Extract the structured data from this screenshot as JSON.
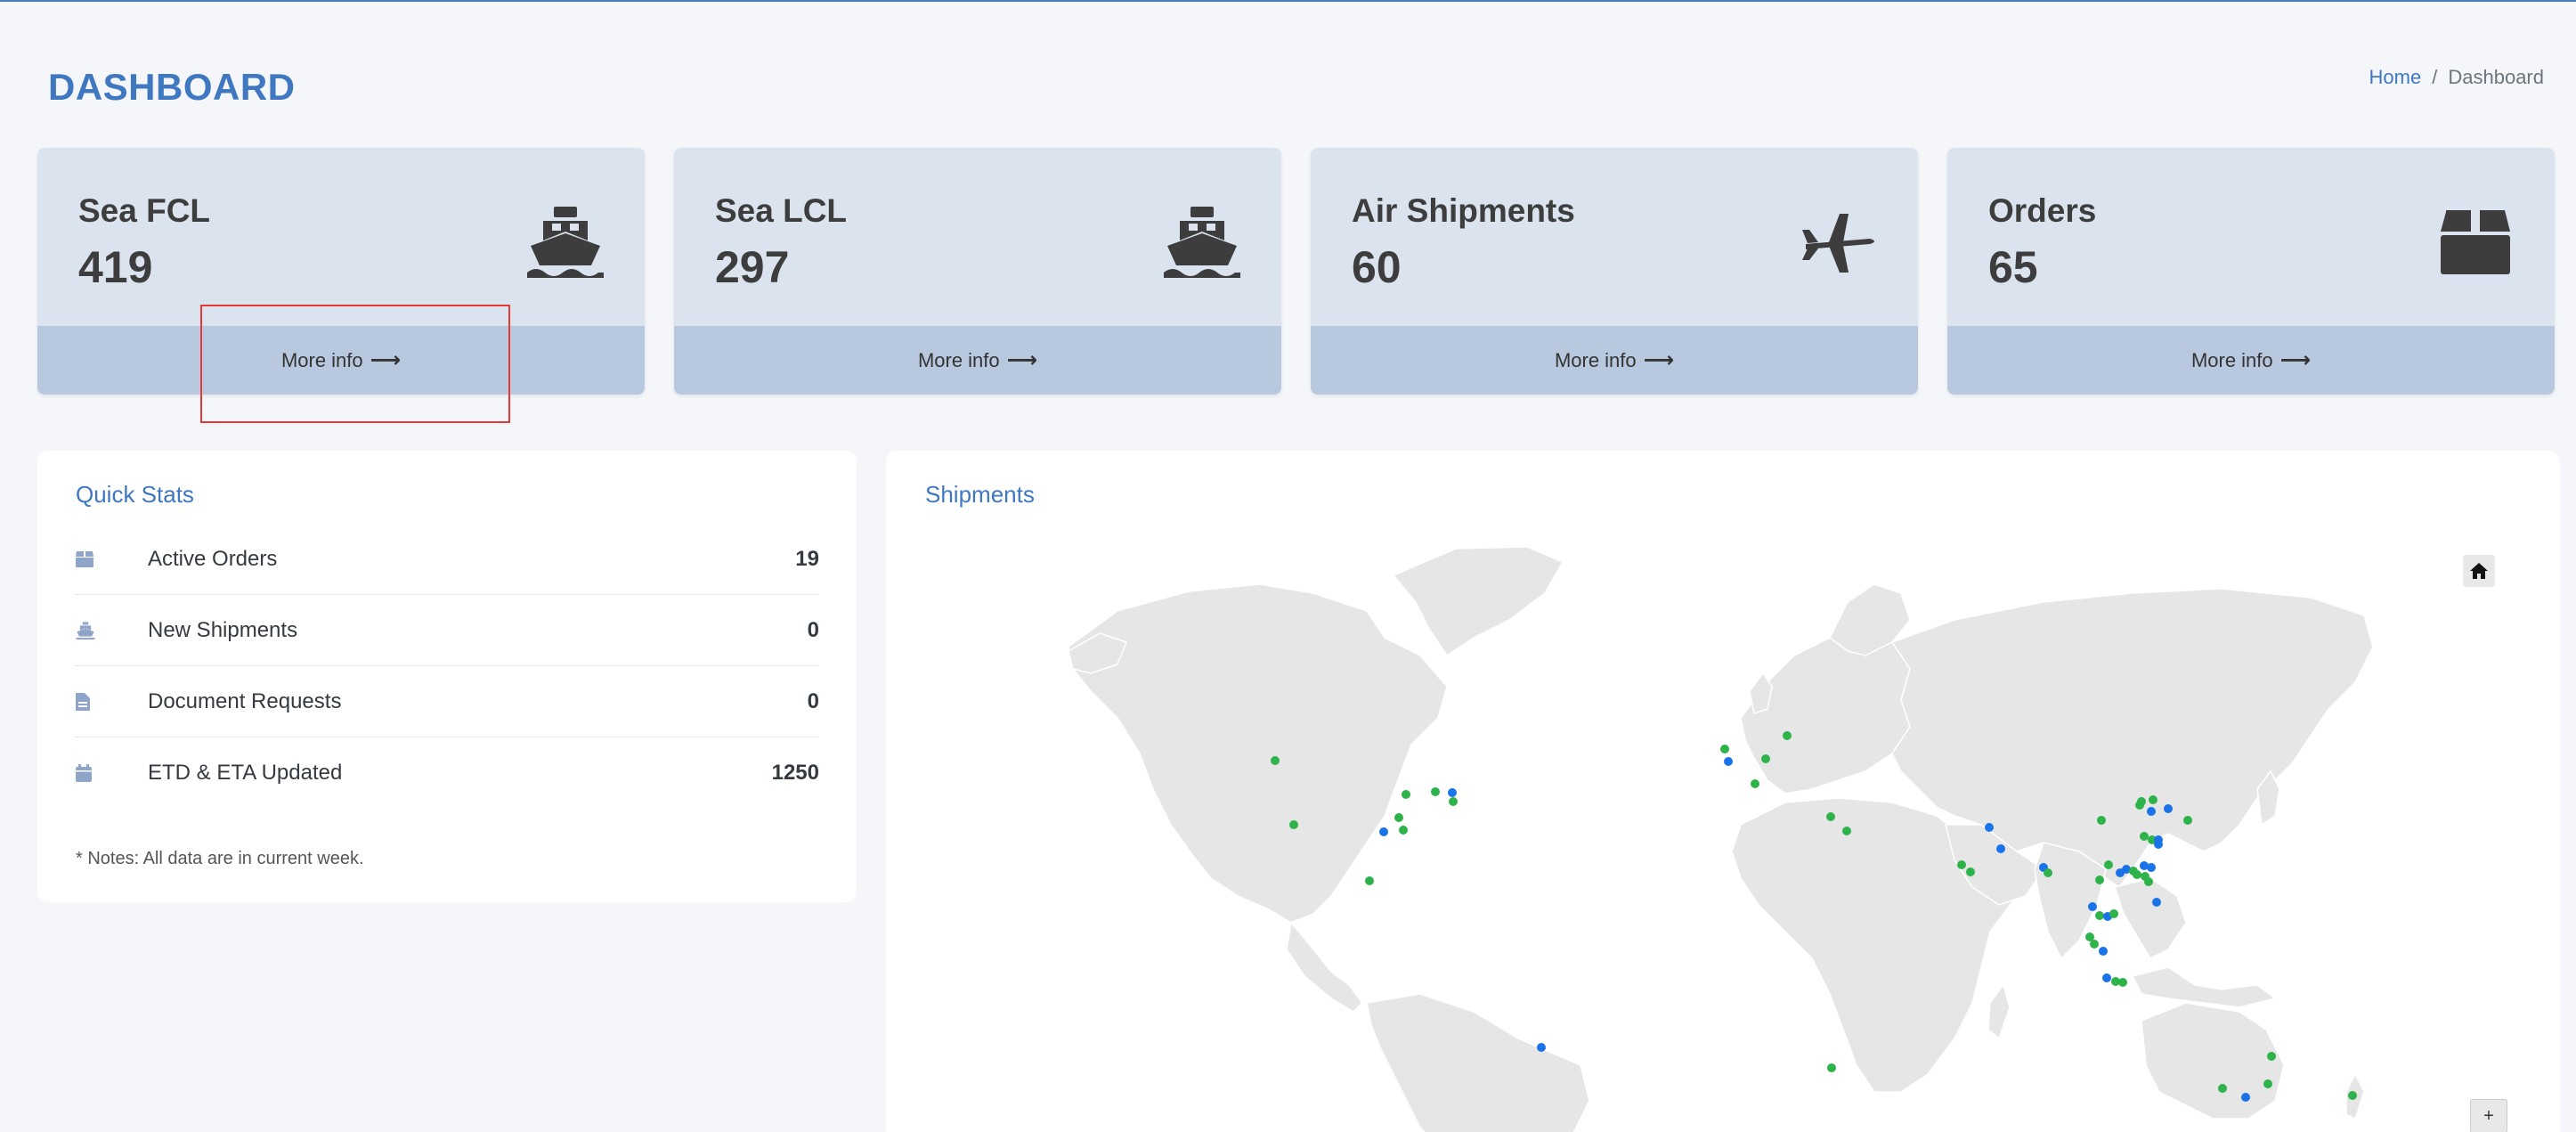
{
  "page": {
    "title": "DASHBOARD"
  },
  "breadcrumb": {
    "home": "Home",
    "separator": "/",
    "current": "Dashboard"
  },
  "cards": [
    {
      "label": "Sea FCL",
      "value": "419",
      "icon": "ship-icon",
      "link": "More info"
    },
    {
      "label": "Sea LCL",
      "value": "297",
      "icon": "ship-icon",
      "link": "More info"
    },
    {
      "label": "Air Shipments",
      "value": "60",
      "icon": "plane-icon",
      "link": "More info"
    },
    {
      "label": "Orders",
      "value": "65",
      "icon": "box-icon",
      "link": "More info"
    }
  ],
  "quick_stats": {
    "title": "Quick Stats",
    "items": [
      {
        "label": "Active Orders",
        "value": "19",
        "icon": "box-icon"
      },
      {
        "label": "New Shipments",
        "value": "0",
        "icon": "ship-icon"
      },
      {
        "label": "Document Requests",
        "value": "0",
        "icon": "document-icon"
      },
      {
        "label": "ETD & ETA Updated",
        "value": "1250",
        "icon": "calendar-icon"
      }
    ],
    "note": "* Notes: All data are in current week."
  },
  "shipments": {
    "title": "Shipments",
    "zoom_in": "+",
    "marker_colors": {
      "green": "#2db34a",
      "blue": "#1a73e8"
    }
  },
  "colors": {
    "accent": "#3f78c0",
    "card_bg": "#dbe3ee",
    "card_footer": "#b8c9df",
    "map_land": "#e6e6e6"
  }
}
